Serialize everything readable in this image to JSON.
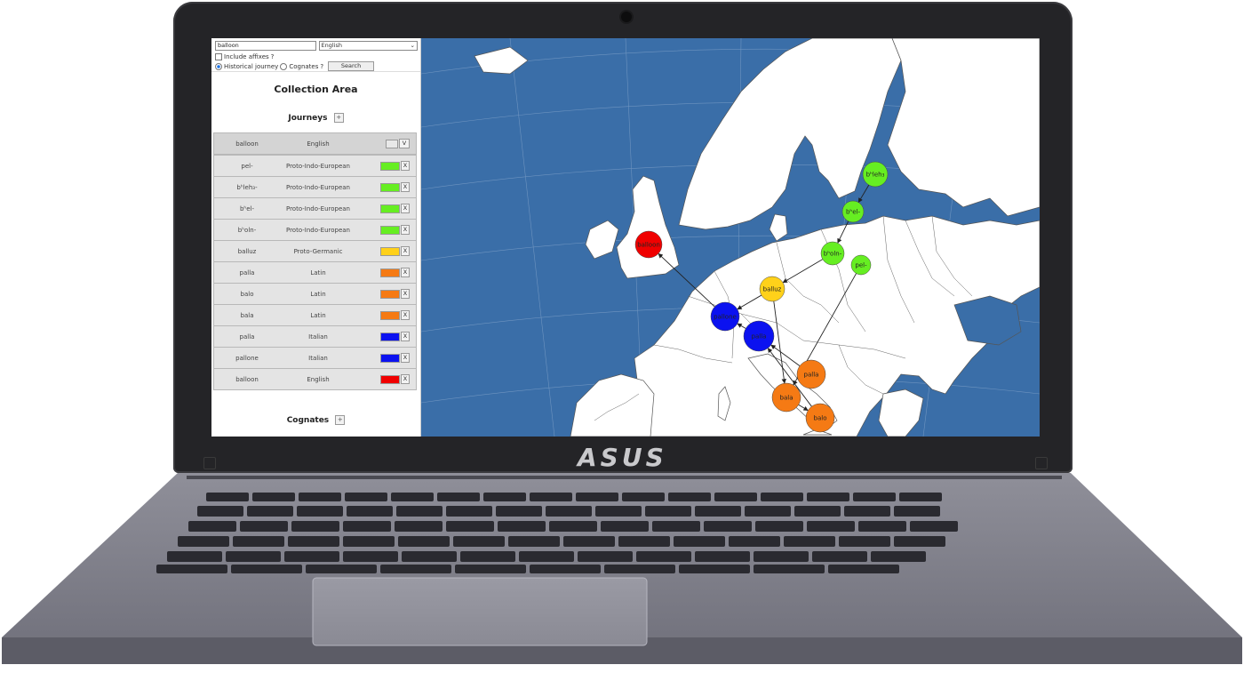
{
  "device": {
    "brand": "ASUS"
  },
  "search": {
    "word_value": "balloon",
    "language_selected": "English",
    "include_affixes_label": "Include affixes",
    "affix_help": "?",
    "mode_historical_label": "Historical journey",
    "mode_cognates_label": "Cognates",
    "cognates_help": "?",
    "search_button": "Search"
  },
  "collection": {
    "title": "Collection Area",
    "journeys_label": "Journeys",
    "add_symbol": "+",
    "cognates_label": "Cognates"
  },
  "journey_header": {
    "word": "balloon",
    "language": "English",
    "toggle_label": "V"
  },
  "journey_rows": [
    {
      "word": "pel-",
      "language": "Proto-Indo-European",
      "color": "#66ee22",
      "remove": "X"
    },
    {
      "word": "bʰleh₃-",
      "language": "Proto-Indo-European",
      "color": "#66ee22",
      "remove": "X"
    },
    {
      "word": "bʰel-",
      "language": "Proto-Indo-European",
      "color": "#66ee22",
      "remove": "X"
    },
    {
      "word": "bʰoln-",
      "language": "Proto-Indo-European",
      "color": "#66ee22",
      "remove": "X"
    },
    {
      "word": "balluz",
      "language": "Proto-Germanic",
      "color": "#ffd11a",
      "remove": "X"
    },
    {
      "word": "palla",
      "language": "Latin",
      "color": "#f57a14",
      "remove": "X"
    },
    {
      "word": "balo",
      "language": "Latin",
      "color": "#f57a14",
      "remove": "X"
    },
    {
      "word": "bala",
      "language": "Latin",
      "color": "#f57a14",
      "remove": "X"
    },
    {
      "word": "palla",
      "language": "Italian",
      "color": "#0b12f0",
      "remove": "X"
    },
    {
      "word": "pallone",
      "language": "Italian",
      "color": "#0b12f0",
      "remove": "X"
    },
    {
      "word": "balloon",
      "language": "English",
      "color": "#f00000",
      "remove": "X"
    }
  ],
  "map": {
    "sea_color": "#3a6ea8",
    "land_color": "#ffffff",
    "nodes": [
      {
        "label": "bʰleh₃",
        "color": "#66ee22"
      },
      {
        "label": "bʰel-",
        "color": "#66ee22"
      },
      {
        "label": "bʰoln-",
        "color": "#66ee22"
      },
      {
        "label": "pel-",
        "color": "#66ee22"
      },
      {
        "label": "balluz",
        "color": "#ffd11a"
      },
      {
        "label": "pallone",
        "color": "#0b12f0"
      },
      {
        "label": "palla",
        "color": "#0b12f0"
      },
      {
        "label": "palla",
        "color": "#f57a14"
      },
      {
        "label": "bala",
        "color": "#f57a14"
      },
      {
        "label": "balo",
        "color": "#f57a14"
      },
      {
        "label": "balloon",
        "color": "#f00000"
      }
    ]
  }
}
